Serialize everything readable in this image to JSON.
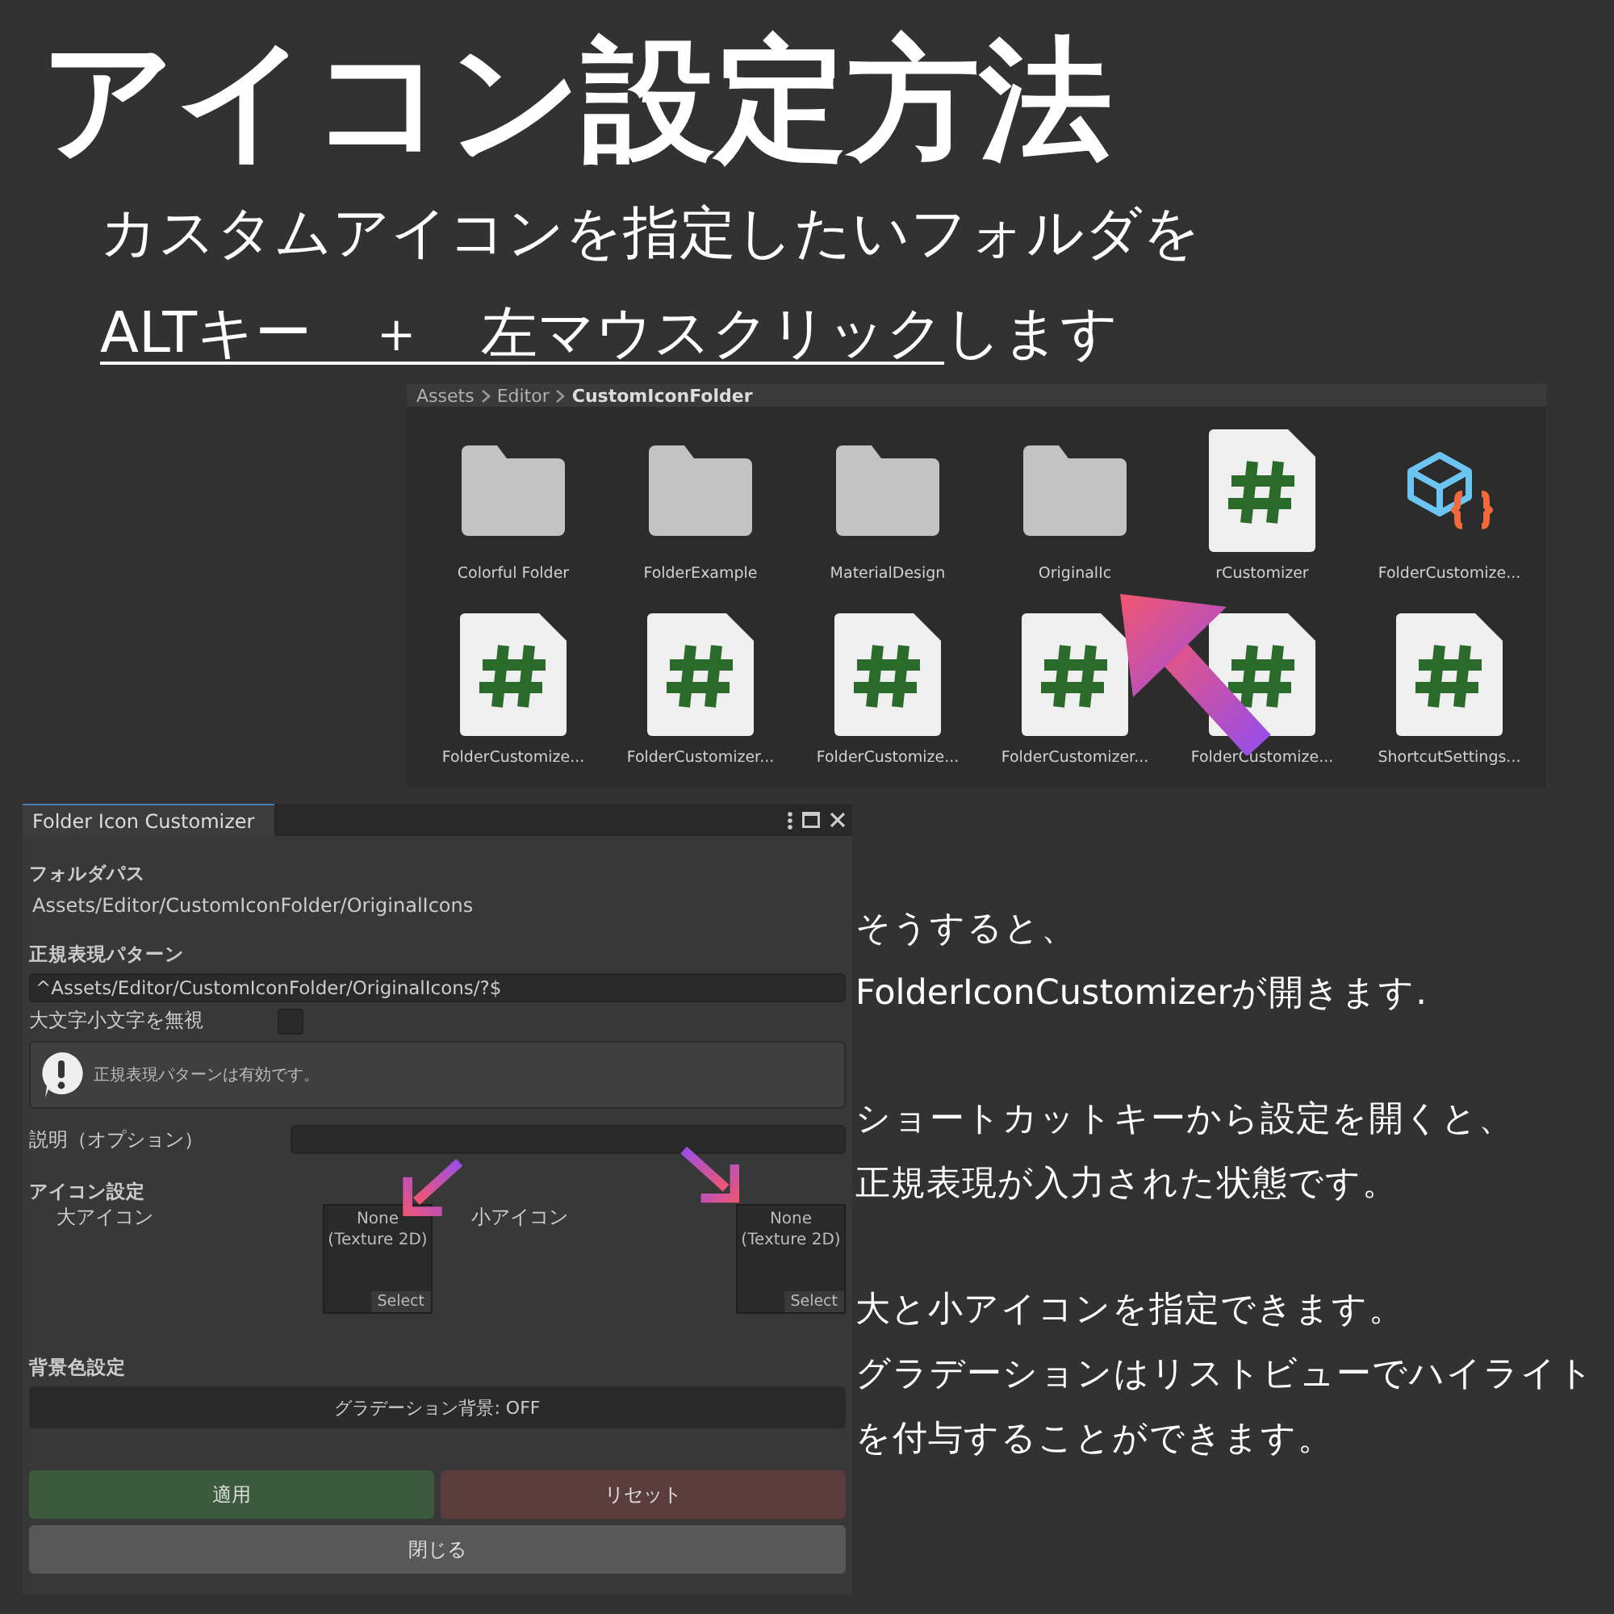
{
  "title": "アイコン設定方法",
  "instructions": {
    "line1": "カスタムアイコンを指定したいフォルダを",
    "line2": [
      {
        "text": "ALTキー　＋　左マウスクリック",
        "underlined": true
      },
      {
        "text": "します",
        "underlined": false
      }
    ]
  },
  "project_browser": {
    "breadcrumb": [
      {
        "label": "Assets",
        "current": false
      },
      {
        "label": "Editor",
        "current": false
      },
      {
        "label": "CustomIconFolder",
        "current": true
      }
    ],
    "items": [
      {
        "label": "Colorful Folder",
        "kind": "folder"
      },
      {
        "label": "FolderExample",
        "kind": "folder"
      },
      {
        "label": "MaterialDesign",
        "kind": "folder"
      },
      {
        "label": "OriginalIc",
        "kind": "folder"
      },
      {
        "label": "rCustomizer",
        "kind": "script"
      },
      {
        "label": "FolderCustomize...",
        "kind": "package"
      },
      {
        "label": "FolderCustomize...",
        "kind": "script"
      },
      {
        "label": "FolderCustomizer...",
        "kind": "script"
      },
      {
        "label": "FolderCustomize...",
        "kind": "script"
      },
      {
        "label": "FolderCustomizer...",
        "kind": "script"
      },
      {
        "label": "FolderCustomize...",
        "kind": "script"
      },
      {
        "label": "ShortcutSettings...",
        "kind": "script"
      }
    ]
  },
  "editor_window": {
    "tab": "Folder Icon Customizer",
    "folder_path": {
      "label": "フォルダパス",
      "value": "Assets/Editor/CustomIconFolder/OriginalIcons"
    },
    "regex": {
      "label": "正規表現パターン",
      "value": "^Assets/Editor/CustomIconFolder/OriginalIcons/?$"
    },
    "ignore_case": {
      "label": "大文字小文字を無視",
      "checked": false
    },
    "help_box": {
      "message": "正規表現パターンは有効です。"
    },
    "description": {
      "label": "説明（オプション）"
    },
    "icon_settings": {
      "heading": "アイコン設定",
      "slots": [
        {
          "label": "大アイコン",
          "value": "None (Texture 2D)",
          "button": "Select"
        },
        {
          "label": "小アイコン",
          "value": "None (Texture 2D)",
          "button": "Select"
        }
      ]
    },
    "background": {
      "heading": "背景色設定",
      "toggle": "グラデーション背景: OFF"
    },
    "buttons": [
      {
        "label": "適用",
        "kind": "apply"
      },
      {
        "label": "リセット",
        "kind": "reset"
      },
      {
        "label": "閉じる",
        "kind": "close"
      }
    ]
  },
  "notes": [
    {
      "lines": [
        "そうすると、",
        "FolderIconCustomizerが開きます."
      ]
    },
    {
      "lines": [
        "ショートカットキーから設定を開くと、",
        "正規表現が入力された状態です。"
      ]
    },
    {
      "lines": [
        "大と小アイコンを指定できます。",
        "グラデーションはリストビューでハイライト",
        "を付与することができます。"
      ]
    }
  ]
}
